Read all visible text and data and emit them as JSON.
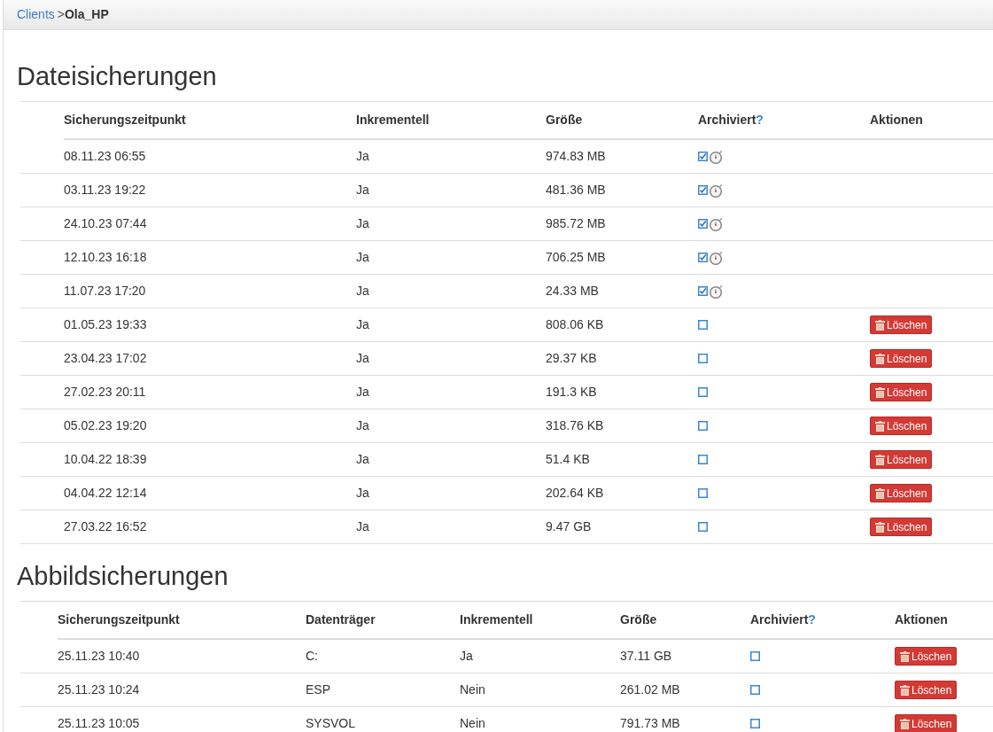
{
  "breadcrumb": {
    "link": "Clients",
    "separator": ">",
    "current": "Ola_HP"
  },
  "file_backups": {
    "title": "Dateisicherungen",
    "columns": [
      "Sicherungszeitpunkt",
      "Inkrementell",
      "Größe",
      "Archiviert",
      "Aktionen"
    ],
    "help_mark": "?",
    "rows": [
      {
        "time": "08.11.23 06:55",
        "incremental": "Ja",
        "size": "974.83 MB",
        "archived": true
      },
      {
        "time": "03.11.23 19:22",
        "incremental": "Ja",
        "size": "481.36 MB",
        "archived": true
      },
      {
        "time": "24.10.23 07:44",
        "incremental": "Ja",
        "size": "985.72 MB",
        "archived": true
      },
      {
        "time": "12.10.23 16:18",
        "incremental": "Ja",
        "size": "706.25 MB",
        "archived": true
      },
      {
        "time": "11.07.23 17:20",
        "incremental": "Ja",
        "size": "24.33 MB",
        "archived": true
      },
      {
        "time": "01.05.23 19:33",
        "incremental": "Ja",
        "size": "808.06 KB",
        "archived": false,
        "action": "Löschen"
      },
      {
        "time": "23.04.23 17:02",
        "incremental": "Ja",
        "size": "29.37 KB",
        "archived": false,
        "action": "Löschen"
      },
      {
        "time": "27.02.23 20:11",
        "incremental": "Ja",
        "size": "191.3 KB",
        "archived": false,
        "action": "Löschen"
      },
      {
        "time": "05.02.23 19:20",
        "incremental": "Ja",
        "size": "318.76 KB",
        "archived": false,
        "action": "Löschen"
      },
      {
        "time": "10.04.22 18:39",
        "incremental": "Ja",
        "size": "51.4 KB",
        "archived": false,
        "action": "Löschen"
      },
      {
        "time": "04.04.22 12:14",
        "incremental": "Ja",
        "size": "202.64 KB",
        "archived": false,
        "action": "Löschen"
      },
      {
        "time": "27.03.22 16:52",
        "incremental": "Ja",
        "size": "9.47 GB",
        "archived": false,
        "action": "Löschen"
      }
    ]
  },
  "image_backups": {
    "title": "Abbildsicherungen",
    "columns": [
      "Sicherungszeitpunkt",
      "Datenträger",
      "Inkrementell",
      "Größe",
      "Archiviert",
      "Aktionen"
    ],
    "help_mark": "?",
    "rows": [
      {
        "time": "25.11.23 10:40",
        "volume": "C:",
        "incremental": "Ja",
        "size": "37.11 GB",
        "archived": false,
        "action": "Löschen"
      },
      {
        "time": "25.11.23 10:24",
        "volume": "ESP",
        "incremental": "Nein",
        "size": "261.02 MB",
        "archived": false,
        "action": "Löschen"
      },
      {
        "time": "25.11.23 10:05",
        "volume": "SYSVOL",
        "incremental": "Nein",
        "size": "791.73 MB",
        "archived": false,
        "action": "Löschen"
      }
    ]
  }
}
